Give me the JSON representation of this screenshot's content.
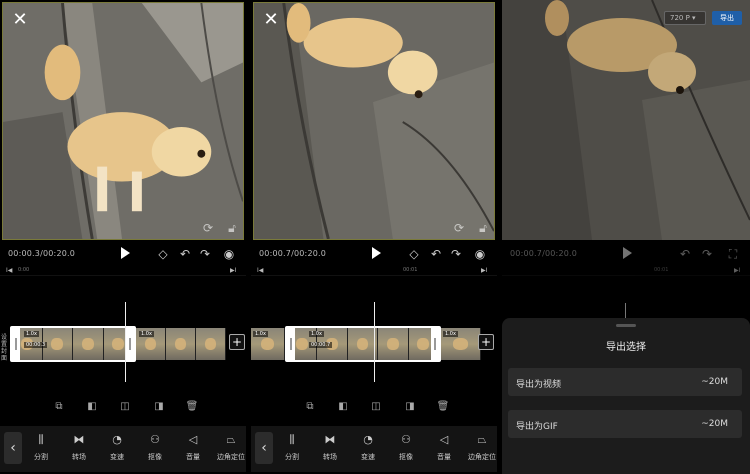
{
  "panels": [
    {
      "timecode": "00:00.3/00:20.0",
      "ruler": {
        "start": "0:00",
        "cap_left": "I◀",
        "cap_right": "▶I",
        "ticks": []
      },
      "clip": {
        "speed_left": "1.0x",
        "clip_time": "00:00.3",
        "speed_right": "1.0x"
      },
      "cover_label": "设置封面",
      "add_label": "+"
    },
    {
      "timecode": "00:00.7/00:20.0",
      "ruler": {
        "start": "",
        "cap_left": "I◀",
        "cap_right": "▶I",
        "ticks": [
          "00:01"
        ]
      },
      "clip": {
        "speed_left": "1.0x",
        "clip_time": "00:00.7",
        "speed_right": "1.0x",
        "speed_prev": "1.0x"
      },
      "add_label": "+"
    }
  ],
  "toolbar": {
    "tools": [
      {
        "label": "分割",
        "icon": "split-icon"
      },
      {
        "label": "转场",
        "icon": "transition-icon"
      },
      {
        "label": "变速",
        "icon": "speed-icon"
      },
      {
        "label": "抠像",
        "icon": "matting-icon"
      },
      {
        "label": "音量",
        "icon": "volume-icon"
      },
      {
        "label": "边角定位",
        "icon": "corner-pin-icon"
      }
    ]
  },
  "export": {
    "timecode": "00:00.7/00:20.0",
    "ruler_tick": "00:01",
    "resolution": "720 P",
    "export_label": "导出",
    "sheet_title": "导出选择",
    "options": [
      {
        "label": "导出为视频",
        "size": "~20M"
      },
      {
        "label": "导出为GIF",
        "size": "~20M"
      }
    ]
  },
  "colors": {
    "accent": "#1f5fa8",
    "clip_border": "#ffffff",
    "preview_border": "#7a7a3a"
  }
}
